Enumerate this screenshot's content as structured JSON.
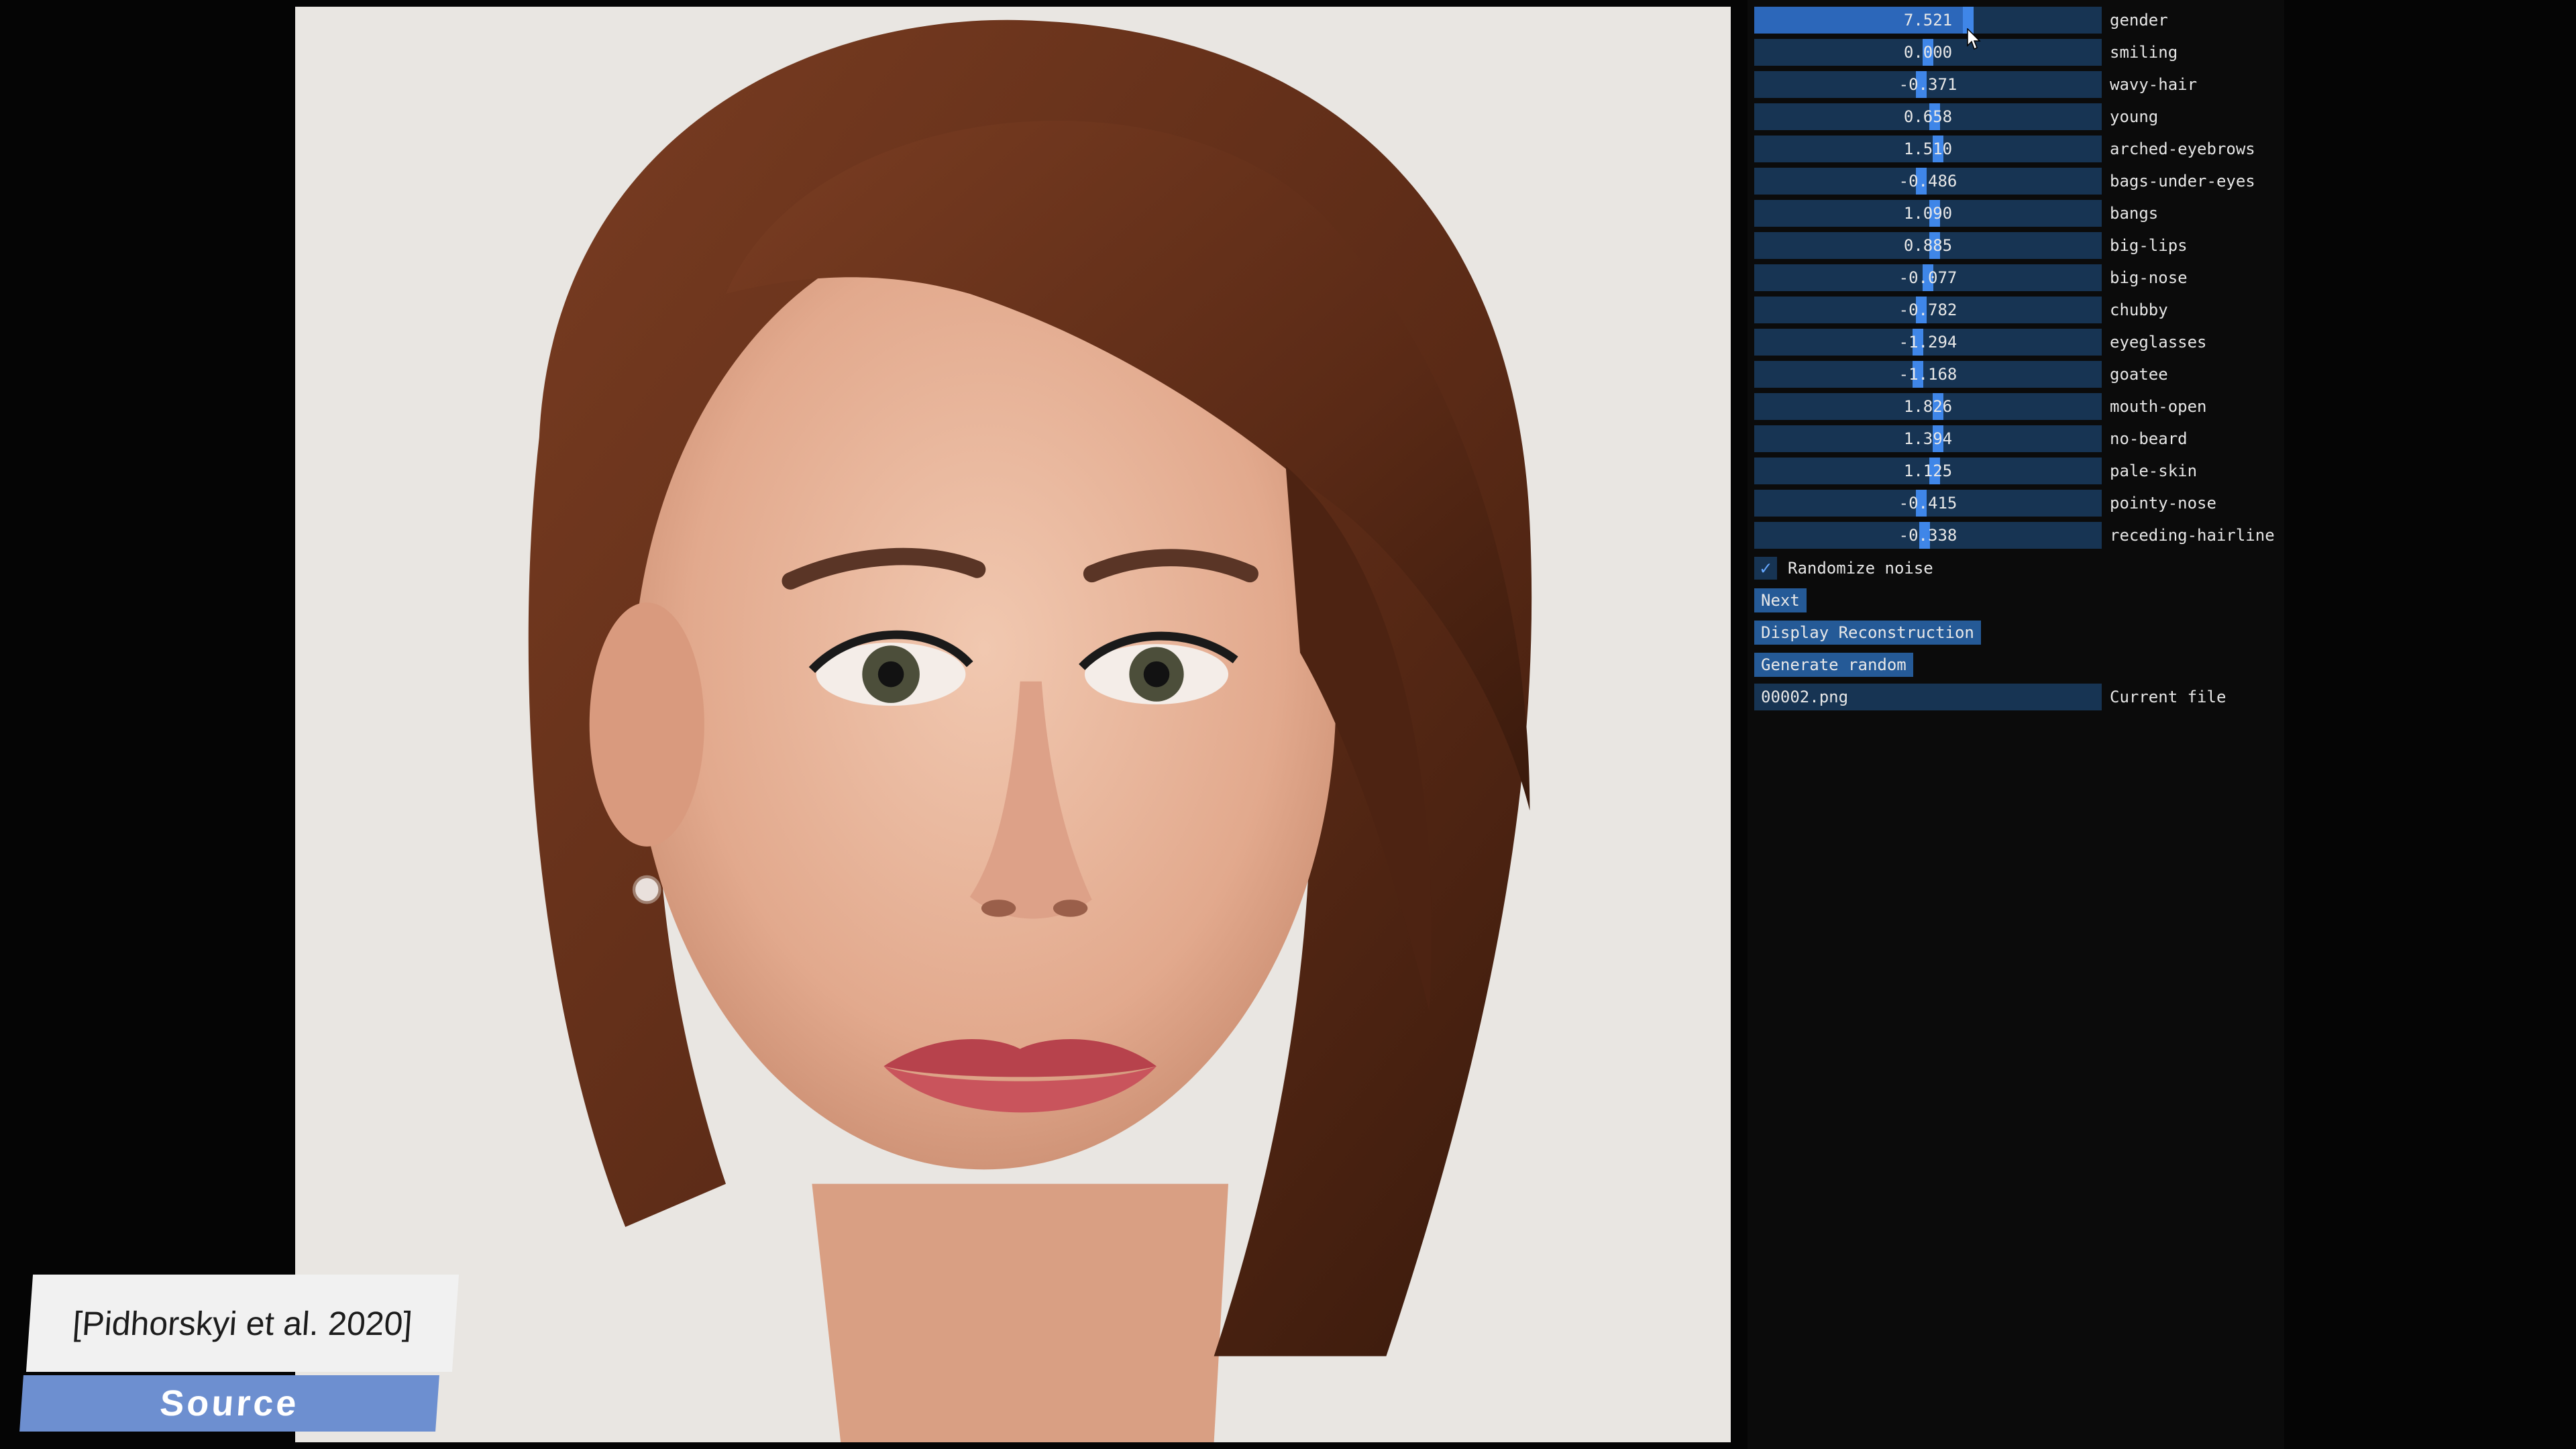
{
  "sliders": [
    {
      "label": "gender",
      "value": "7.521",
      "fill": 0.62
    },
    {
      "label": "smiling",
      "value": "0.000",
      "fill": 0.5
    },
    {
      "label": "wavy-hair",
      "value": "-0.371",
      "fill": 0.48
    },
    {
      "label": "young",
      "value": "0.658",
      "fill": 0.52
    },
    {
      "label": "arched-eyebrows",
      "value": "1.510",
      "fill": 0.53
    },
    {
      "label": "bags-under-eyes",
      "value": "-0.486",
      "fill": 0.48
    },
    {
      "label": "bangs",
      "value": "1.090",
      "fill": 0.52
    },
    {
      "label": "big-lips",
      "value": "0.885",
      "fill": 0.52
    },
    {
      "label": "big-nose",
      "value": "-0.077",
      "fill": 0.5
    },
    {
      "label": "chubby",
      "value": "-0.782",
      "fill": 0.48
    },
    {
      "label": "eyeglasses",
      "value": "-1.294",
      "fill": 0.47
    },
    {
      "label": "goatee",
      "value": "-1.168",
      "fill": 0.47
    },
    {
      "label": "mouth-open",
      "value": "1.826",
      "fill": 0.53
    },
    {
      "label": "no-beard",
      "value": "1.394",
      "fill": 0.53
    },
    {
      "label": "pale-skin",
      "value": "1.125",
      "fill": 0.52
    },
    {
      "label": "pointy-nose",
      "value": "-0.415",
      "fill": 0.48
    },
    {
      "label": "receding-hairline",
      "value": "-0.338",
      "fill": 0.49
    }
  ],
  "checkbox": {
    "label": "Randomize noise",
    "checked": true
  },
  "buttons": {
    "next": "Next",
    "display_reconstruction": "Display Reconstruction",
    "generate_random": "Generate random"
  },
  "file": {
    "value": "00002.png",
    "label": "Current file"
  },
  "overlay": {
    "citation": "[Pidhorskyi et al. 2020]",
    "source": "Source"
  },
  "colors": {
    "track": "#173453",
    "fill": "#2c67ba",
    "grab": "#3f86e8",
    "button": "#255a97",
    "source_banner": "#6d8fd0"
  }
}
